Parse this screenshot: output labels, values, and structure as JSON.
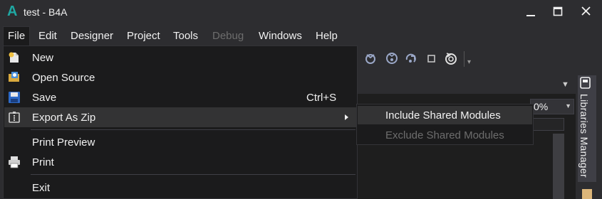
{
  "window": {
    "title": "test - B4A",
    "logo_letter": "A",
    "accent_color": "#1fa8a3"
  },
  "menubar": {
    "items": [
      {
        "label": "File",
        "state": "open"
      },
      {
        "label": "Edit"
      },
      {
        "label": "Designer"
      },
      {
        "label": "Project"
      },
      {
        "label": "Tools"
      },
      {
        "label": "Debug",
        "state": "disabled"
      },
      {
        "label": "Windows"
      },
      {
        "label": "Help"
      }
    ]
  },
  "file_menu": {
    "items": [
      {
        "label": "New",
        "icon": "new-file-icon"
      },
      {
        "label": "Open Source",
        "icon": "open-source-icon"
      },
      {
        "label": "Save",
        "icon": "save-icon",
        "shortcut": "Ctrl+S"
      },
      {
        "label": "Export As Zip",
        "icon": "zip-icon",
        "has_submenu": true,
        "highlighted": true
      },
      {
        "label": "Print Preview"
      },
      {
        "label": "Print",
        "icon": "printer-icon"
      },
      {
        "label": "Exit"
      }
    ]
  },
  "export_submenu": {
    "items": [
      {
        "label": "Include Shared Modules",
        "highlighted": true
      },
      {
        "label": "Exclude Shared Modules",
        "disabled": true
      }
    ]
  },
  "toolbar": {
    "icons": [
      "step-into-icon",
      "step-over-icon",
      "step-out-icon",
      "stop-icon",
      "restart-icon",
      "toolbar-overflow-icon"
    ]
  },
  "editor": {
    "zoom_value": "0%"
  },
  "side_panel": {
    "libraries_tab_label": "Libraries Manager"
  }
}
